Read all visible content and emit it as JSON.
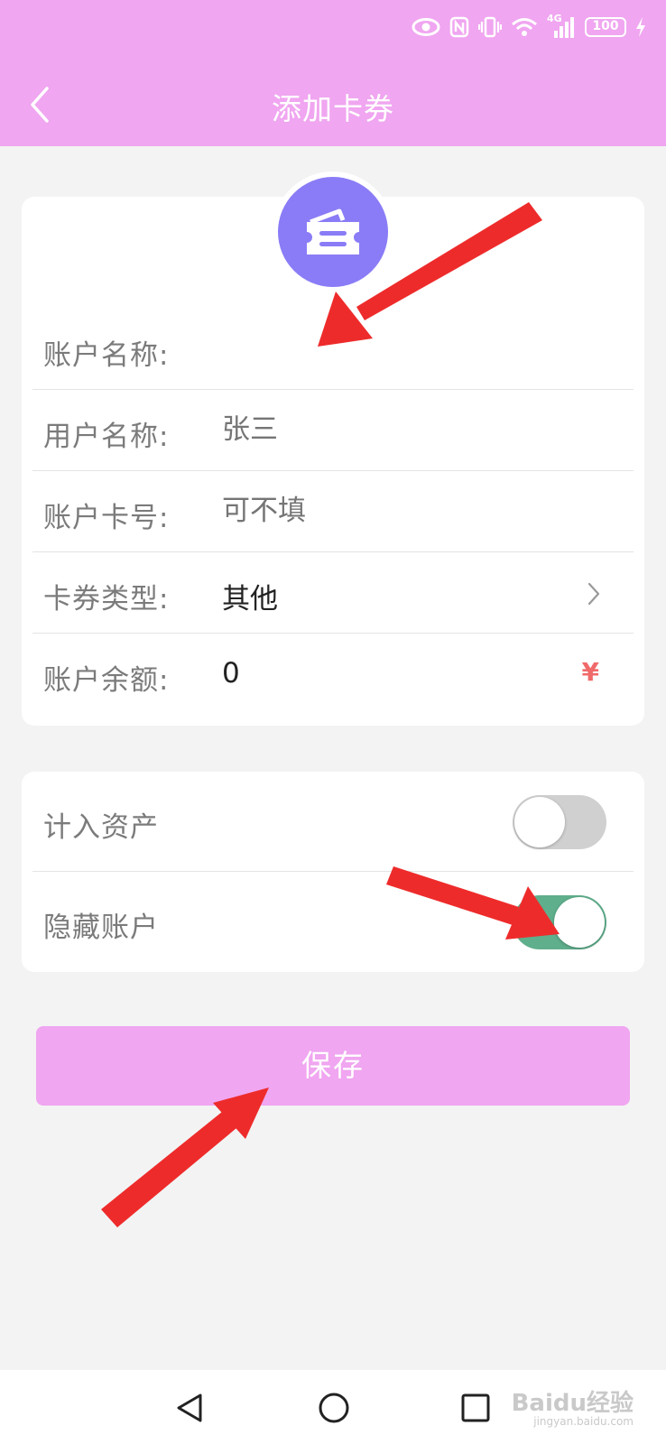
{
  "status_bar": {
    "network": "4G",
    "battery": "100",
    "icons": [
      "eye-icon",
      "nfc-icon",
      "vibrate-icon",
      "wifi-icon",
      "signal-icon",
      "battery-icon",
      "charging-icon"
    ]
  },
  "header": {
    "title": "添加卡券",
    "back_icon": "chevron-left-icon"
  },
  "form": {
    "card_icon": "ticket-icon",
    "account_name": {
      "label": "账户名称:",
      "value": ""
    },
    "user_name": {
      "label": "用户名称:",
      "placeholder": "张三"
    },
    "card_number": {
      "label": "账户卡号:",
      "placeholder": "可不填"
    },
    "card_type": {
      "label": "卡券类型:",
      "value": "其他",
      "icon": "chevron-right-icon"
    },
    "balance": {
      "label": "账户余额:",
      "value": "0",
      "currency": "¥"
    }
  },
  "settings": {
    "include_assets": {
      "label": "计入资产",
      "on": false
    },
    "hide_account": {
      "label": "隐藏账户",
      "on": true
    }
  },
  "save_button": {
    "label": "保存"
  },
  "nav_bar": {
    "icons": [
      "back-triangle-icon",
      "home-circle-icon",
      "recents-square-icon"
    ]
  },
  "watermark": {
    "text": "Baidu经验",
    "sub": "jingyan.baidu.com"
  },
  "colors": {
    "accent": "#f0a6f0",
    "card_icon_bg": "#8a7cf6",
    "toggle_on": "#5fae8c",
    "arrow": "#ee2b2b",
    "yen": "#f06a6a"
  }
}
